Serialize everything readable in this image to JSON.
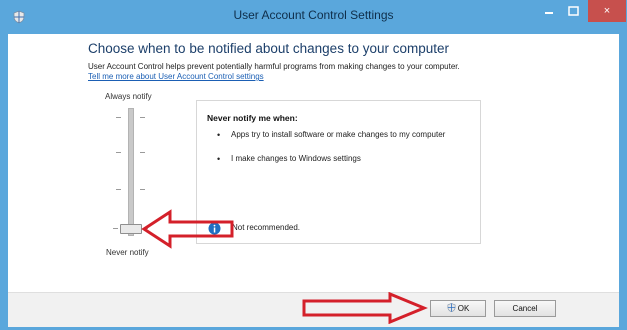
{
  "window": {
    "title": "User Account Control Settings",
    "minimize_label": "–",
    "maximize_label": "□",
    "close_label": "×"
  },
  "main": {
    "heading": "Choose when to be notified about changes to your computer",
    "description": "User Account Control helps prevent potentially harmful programs from making changes to your computer.",
    "link": "Tell me more about User Account Control settings"
  },
  "slider": {
    "top_label": "Always notify",
    "bottom_label": "Never notify",
    "level": 0,
    "levels_total": 4
  },
  "info": {
    "title": "Never notify me when:",
    "bullets": [
      "Apps try to install software or make changes to my computer",
      "I make changes to Windows settings"
    ],
    "warning": "Not recommended."
  },
  "buttons": {
    "ok": "OK",
    "cancel": "Cancel"
  },
  "colors": {
    "titlebar": "#5aa7dc",
    "heading": "#1c3f6a",
    "link": "#1b5fb4",
    "close_button": "#c7504d",
    "annotation_arrow": "#d4202a"
  },
  "icons": {
    "app": "uac-shield-icon",
    "info": "info-icon",
    "ok_shield": "shield-icon"
  }
}
